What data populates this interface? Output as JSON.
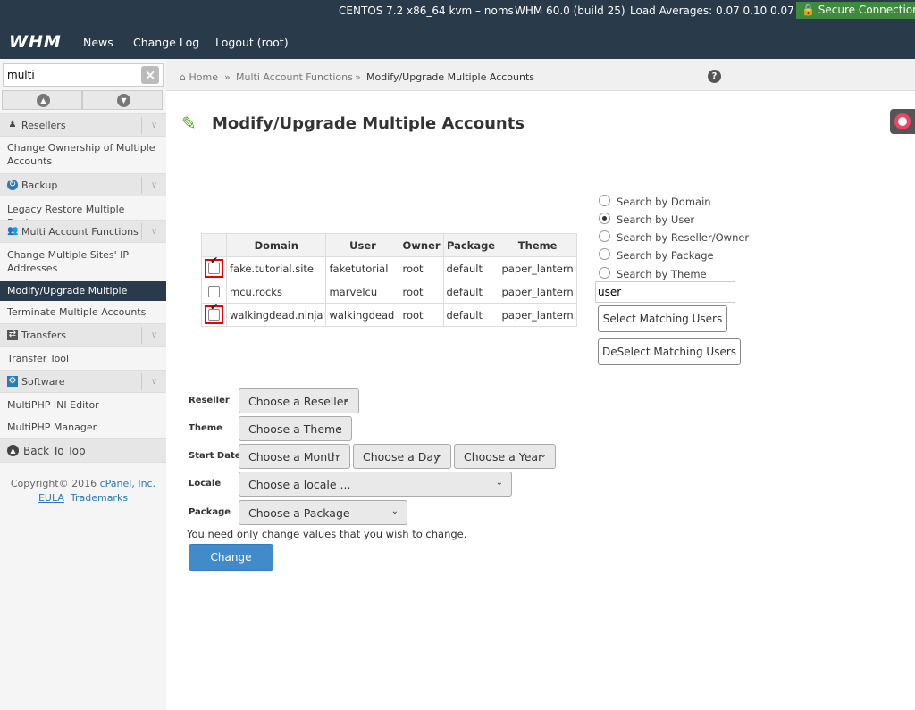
{
  "topbar": {
    "server": "CENTOS 7.2 x86_64 kvm – noms",
    "version": "WHM 60.0 (build 25)",
    "load": "Load Averages: 0.07 0.10 0.07",
    "secure": "Secure Connection",
    "logo": "WHM",
    "nav": [
      "News",
      "Change Log",
      "Logout (root)"
    ]
  },
  "sidebar": {
    "search_value": "multi",
    "categories": [
      {
        "label": "Resellers",
        "icon": "reseller-icon",
        "items": [
          "Change Ownership of Multiple Accounts"
        ]
      },
      {
        "label": "Backup",
        "icon": "backup-icon",
        "items": [
          "Legacy Restore Multiple Backups"
        ]
      },
      {
        "label": "Multi Account Functions",
        "icon": "multi-account-icon",
        "items": [
          "Change Multiple Sites' IP Addresses",
          "Modify/Upgrade Multiple Accounts",
          "Terminate Multiple Accounts"
        ]
      },
      {
        "label": "Transfers",
        "icon": "transfers-icon",
        "items": [
          "Transfer Tool"
        ]
      },
      {
        "label": "Software",
        "icon": "software-icon",
        "items": [
          "MultiPHP INI Editor",
          "MultiPHP Manager"
        ]
      }
    ],
    "active_item": "Modify/Upgrade Multiple Accounts",
    "back_to_top": "Back To Top",
    "copyright_prefix": "Copyright© 2016",
    "copyright_link": "cPanel, Inc.",
    "eula": "EULA",
    "trademarks": "Trademarks"
  },
  "breadcrumb": {
    "home": "Home",
    "section": "Multi Account Functions",
    "current": "Modify/Upgrade Multiple Accounts"
  },
  "page": {
    "title": "Modify/Upgrade Multiple Accounts"
  },
  "table": {
    "headers": [
      "Domain",
      "User",
      "Owner",
      "Package",
      "Theme"
    ],
    "rows": [
      {
        "checked": true,
        "highlighted": true,
        "domain": "fake.tutorial.site",
        "user": "faketutorial",
        "owner": "root",
        "package": "default",
        "theme": "paper_lantern"
      },
      {
        "checked": false,
        "highlighted": false,
        "domain": "mcu.rocks",
        "user": "marvelcu",
        "owner": "root",
        "package": "default",
        "theme": "paper_lantern"
      },
      {
        "checked": true,
        "highlighted": true,
        "domain": "walkingdead.ninja",
        "user": "walkingdead",
        "owner": "root",
        "package": "default",
        "theme": "paper_lantern"
      }
    ]
  },
  "search": {
    "options": [
      "Search by Domain",
      "Search by User",
      "Search by Reseller/Owner",
      "Search by Package",
      "Search by Theme"
    ],
    "selected": "Search by User",
    "value": "user",
    "select_button": "Select Matching Users",
    "deselect_button": "DeSelect Matching Users"
  },
  "form": {
    "reseller_label": "Reseller",
    "reseller_value": "Choose a Reseller",
    "theme_label": "Theme",
    "theme_value": "Choose a Theme",
    "start_date_label": "Start Date",
    "month_value": "Choose a Month",
    "day_value": "Choose a Day",
    "year_value": "Choose a Year",
    "locale_label": "Locale",
    "locale_value": "Choose a locale ...",
    "package_label": "Package",
    "package_value": "Choose a Package",
    "hint": "You need only change values that you wish to change.",
    "submit": "Change"
  }
}
